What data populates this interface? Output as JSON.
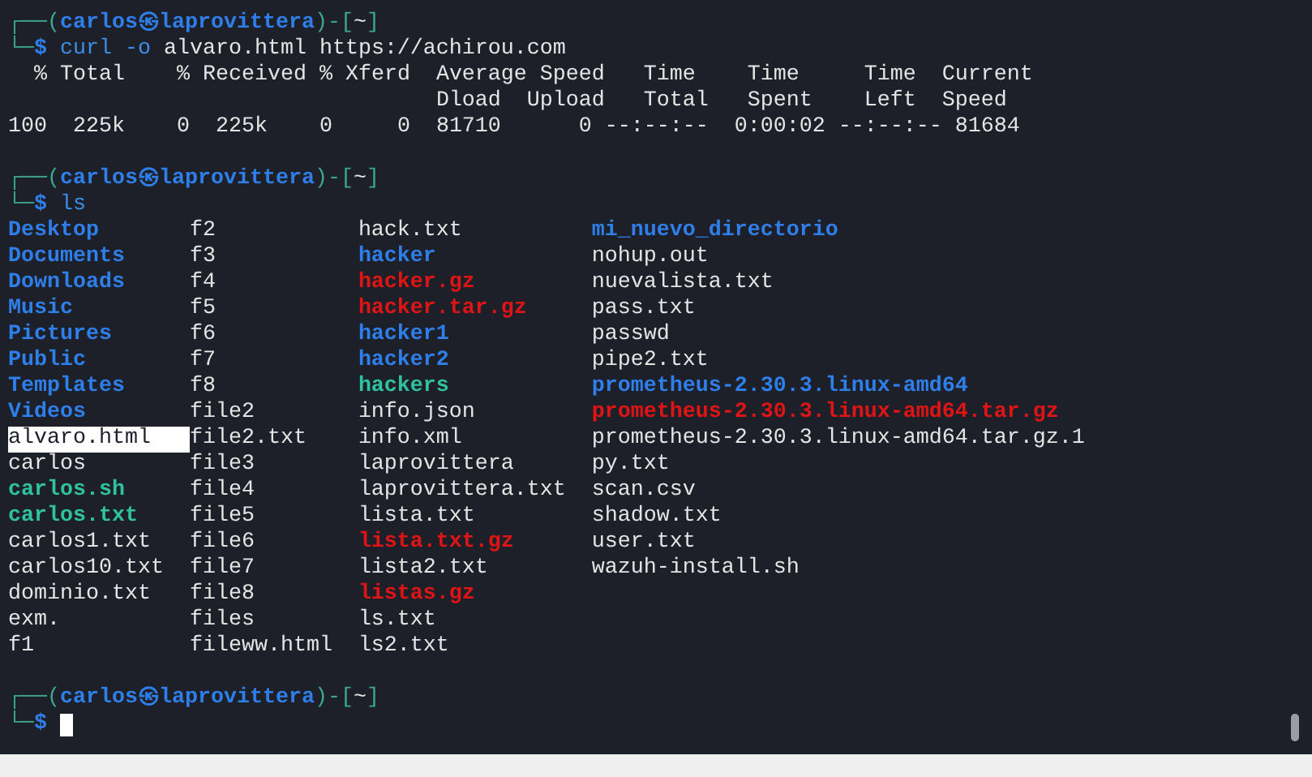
{
  "blocks": [
    {
      "kind": "prompt",
      "frame_open": "┌──(",
      "user": "carlos",
      "at": "㉿",
      "host": "laprovittera",
      "frame_mid": ")-[",
      "path": "~",
      "frame_close": "]",
      "frame_bottom": "└─",
      "symbol": "$",
      "command": "curl -o",
      "args": "alvaro.html https://achirou.com"
    },
    {
      "kind": "output",
      "lines": [
        "  % Total    % Received % Xferd  Average Speed   Time    Time     Time  Current",
        "                                 Dload  Upload   Total   Spent    Left  Speed",
        "100  225k    0  225k    0     0  81710      0 --:--:--  0:00:02 --:--:-- 81684"
      ]
    },
    {
      "kind": "prompt",
      "frame_open": "┌──(",
      "user": "carlos",
      "at": "㉿",
      "host": "laprovittera",
      "frame_mid": ")-[",
      "path": "~",
      "frame_close": "]",
      "frame_bottom": "└─",
      "symbol": "$",
      "command": "ls"
    },
    {
      "kind": "listing",
      "columns": [
        [
          {
            "name": "Desktop",
            "kind": "dir"
          },
          {
            "name": "Documents",
            "kind": "dir"
          },
          {
            "name": "Downloads",
            "kind": "dir"
          },
          {
            "name": "Music",
            "kind": "dir"
          },
          {
            "name": "Pictures",
            "kind": "dir"
          },
          {
            "name": "Public",
            "kind": "dir"
          },
          {
            "name": "Templates",
            "kind": "dir"
          },
          {
            "name": "Videos",
            "kind": "dir"
          },
          {
            "name": "alvaro.html",
            "kind": "highlight"
          },
          {
            "name": "carlos",
            "kind": "file"
          },
          {
            "name": "carlos.sh",
            "kind": "exec"
          },
          {
            "name": "carlos.txt",
            "kind": "exec"
          },
          {
            "name": "carlos1.txt",
            "kind": "file"
          },
          {
            "name": "carlos10.txt",
            "kind": "file"
          },
          {
            "name": "dominio.txt",
            "kind": "file"
          },
          {
            "name": "exm.",
            "kind": "file"
          },
          {
            "name": "f1",
            "kind": "file"
          }
        ],
        [
          {
            "name": "f2",
            "kind": "file"
          },
          {
            "name": "f3",
            "kind": "file"
          },
          {
            "name": "f4",
            "kind": "file"
          },
          {
            "name": "f5",
            "kind": "file"
          },
          {
            "name": "f6",
            "kind": "file"
          },
          {
            "name": "f7",
            "kind": "file"
          },
          {
            "name": "f8",
            "kind": "file"
          },
          {
            "name": "file2",
            "kind": "file"
          },
          {
            "name": "file2.txt",
            "kind": "file"
          },
          {
            "name": "file3",
            "kind": "file"
          },
          {
            "name": "file4",
            "kind": "file"
          },
          {
            "name": "file5",
            "kind": "file"
          },
          {
            "name": "file6",
            "kind": "file"
          },
          {
            "name": "file7",
            "kind": "file"
          },
          {
            "name": "file8",
            "kind": "file"
          },
          {
            "name": "files",
            "kind": "file"
          },
          {
            "name": "fileww.html",
            "kind": "file"
          }
        ],
        [
          {
            "name": "hack.txt",
            "kind": "file"
          },
          {
            "name": "hacker",
            "kind": "dir"
          },
          {
            "name": "hacker.gz",
            "kind": "archive"
          },
          {
            "name": "hacker.tar.gz",
            "kind": "archive"
          },
          {
            "name": "hacker1",
            "kind": "dir"
          },
          {
            "name": "hacker2",
            "kind": "dir"
          },
          {
            "name": "hackers",
            "kind": "exec"
          },
          {
            "name": "info.json",
            "kind": "file"
          },
          {
            "name": "info.xml",
            "kind": "file"
          },
          {
            "name": "laprovittera",
            "kind": "file"
          },
          {
            "name": "laprovittera.txt",
            "kind": "file"
          },
          {
            "name": "lista.txt",
            "kind": "file"
          },
          {
            "name": "lista.txt.gz",
            "kind": "archive"
          },
          {
            "name": "lista2.txt",
            "kind": "file"
          },
          {
            "name": "listas.gz",
            "kind": "archive"
          },
          {
            "name": "ls.txt",
            "kind": "file"
          },
          {
            "name": "ls2.txt",
            "kind": "file"
          }
        ],
        [
          {
            "name": "mi_nuevo_directorio",
            "kind": "dir"
          },
          {
            "name": "nohup.out",
            "kind": "file"
          },
          {
            "name": "nuevalista.txt",
            "kind": "file"
          },
          {
            "name": "pass.txt",
            "kind": "file"
          },
          {
            "name": "passwd",
            "kind": "file"
          },
          {
            "name": "pipe2.txt",
            "kind": "file"
          },
          {
            "name": "prometheus-2.30.3.linux-amd64",
            "kind": "dir"
          },
          {
            "name": "prometheus-2.30.3.linux-amd64.tar.gz",
            "kind": "archive"
          },
          {
            "name": "prometheus-2.30.3.linux-amd64.tar.gz.1",
            "kind": "file"
          },
          {
            "name": "py.txt",
            "kind": "file"
          },
          {
            "name": "scan.csv",
            "kind": "file"
          },
          {
            "name": "shadow.txt",
            "kind": "file"
          },
          {
            "name": "user.txt",
            "kind": "file"
          },
          {
            "name": "wazuh-install.sh",
            "kind": "file"
          }
        ]
      ]
    },
    {
      "kind": "prompt",
      "frame_open": "┌──(",
      "user": "carlos",
      "at": "㉿",
      "host": "laprovittera",
      "frame_mid": ")-[",
      "path": "~",
      "frame_close": "]",
      "frame_bottom": "└─",
      "symbol": "$",
      "cursor": true
    }
  ]
}
